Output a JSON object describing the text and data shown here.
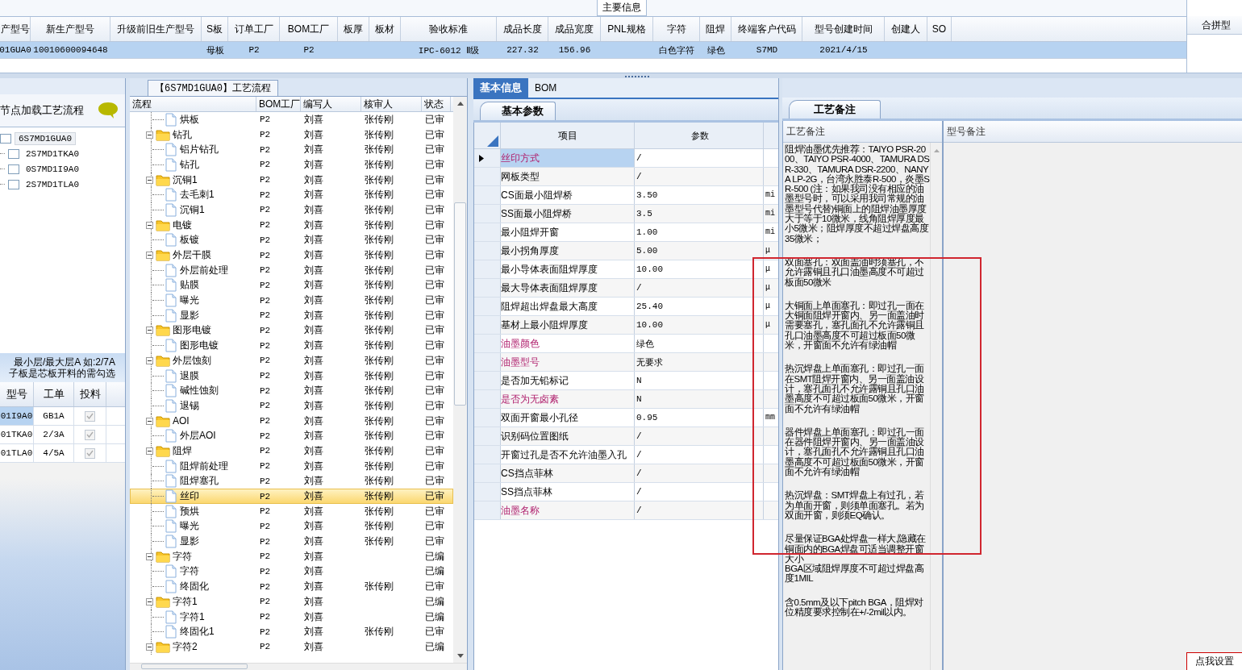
{
  "main_info": {
    "title": "主要信息",
    "columns": [
      "产型号",
      "新生产型号",
      "升级前旧生产型号",
      "S板",
      "订单工厂",
      "BOM工厂",
      "板厚",
      "板材",
      "验收标准",
      "成品长度",
      "成品宽度",
      "PNL规格",
      "字符",
      "阻焊",
      "终端客户代码",
      "型号创建时间",
      "创建人",
      "SO"
    ],
    "rows": [
      {
        "selected": true,
        "cells": [
          "01GUA0",
          "10010600094648",
          null,
          "母板",
          "P2",
          "P2",
          null,
          null,
          "IPC-6012 Ⅱ级",
          "227.32",
          "156.96",
          null,
          "白色字符",
          "绿色",
          "S7MD",
          "2021/4/15",
          null,
          null
        ]
      }
    ],
    "merge_title": "合拼型"
  },
  "left_panel": {
    "title": "节点加载工艺流程",
    "tree": {
      "label": "6S7MD1GUA0",
      "checked": false,
      "selected": true,
      "children": [
        {
          "label": "2S7MD1TKA0",
          "checked": false,
          "selected": false
        },
        {
          "label": "0S7MD1I9A0",
          "checked": false,
          "selected": false
        },
        {
          "label": "2S7MD1TLA0",
          "checked": false,
          "selected": false
        }
      ]
    },
    "note": [
      "最小层/最大层A 如:2/7A",
      "子板是芯板开料的需勾选"
    ],
    "columns": [
      "型号",
      "工单",
      "投料"
    ],
    "rows": [
      {
        "model": "01I9A0",
        "order": "GB1A",
        "fed": true,
        "selected": true
      },
      {
        "model": "01TKA0",
        "order": "2/3A",
        "fed": true,
        "selected": false
      },
      {
        "model": "01TLA0",
        "order": "4/5A",
        "fed": true,
        "selected": false
      }
    ]
  },
  "flow": {
    "title": "【6S7MD1GUA0】工艺流程",
    "columns": [
      "流程",
      "BOM工厂",
      "编写人",
      "核审人",
      "状态"
    ],
    "rows": [
      {
        "kind": "file",
        "name": "烘板",
        "bom": "P2",
        "writer": "刘喜",
        "reviewer": "张传刚",
        "status": "已审",
        "selected": false
      },
      {
        "kind": "folder",
        "name": "钻孔",
        "bom": "P2",
        "writer": "刘喜",
        "reviewer": "张传刚",
        "status": "已审",
        "selected": false,
        "expanded": true,
        "children": [
          {
            "kind": "file",
            "name": "铝片钻孔",
            "bom": "P2",
            "writer": "刘喜",
            "reviewer": "张传刚",
            "status": "已审",
            "selected": false
          },
          {
            "kind": "file",
            "name": "钻孔",
            "bom": "P2",
            "writer": "刘喜",
            "reviewer": "张传刚",
            "status": "已审",
            "selected": false
          }
        ]
      },
      {
        "kind": "folder",
        "name": "沉铜1",
        "bom": "P2",
        "writer": "刘喜",
        "reviewer": "张传刚",
        "status": "已审",
        "selected": false,
        "expanded": true,
        "children": [
          {
            "kind": "file",
            "name": "去毛刺1",
            "bom": "P2",
            "writer": "刘喜",
            "reviewer": "张传刚",
            "status": "已审",
            "selected": false
          },
          {
            "kind": "file",
            "name": "沉铜1",
            "bom": "P2",
            "writer": "刘喜",
            "reviewer": "张传刚",
            "status": "已审",
            "selected": false
          }
        ]
      },
      {
        "kind": "folder",
        "name": "电镀",
        "bom": "P2",
        "writer": "刘喜",
        "reviewer": "张传刚",
        "status": "已审",
        "selected": false,
        "expanded": true,
        "children": [
          {
            "kind": "file",
            "name": "板镀",
            "bom": "P2",
            "writer": "刘喜",
            "reviewer": "张传刚",
            "status": "已审",
            "selected": false
          }
        ]
      },
      {
        "kind": "folder",
        "name": "外层干膜",
        "bom": "P2",
        "writer": "刘喜",
        "reviewer": "张传刚",
        "status": "已审",
        "selected": false,
        "expanded": true,
        "children": [
          {
            "kind": "file",
            "name": "外层前处理",
            "bom": "P2",
            "writer": "刘喜",
            "reviewer": "张传刚",
            "status": "已审",
            "selected": false
          },
          {
            "kind": "file",
            "name": "贴膜",
            "bom": "P2",
            "writer": "刘喜",
            "reviewer": "张传刚",
            "status": "已审",
            "selected": false
          },
          {
            "kind": "file",
            "name": "曝光",
            "bom": "P2",
            "writer": "刘喜",
            "reviewer": "张传刚",
            "status": "已审",
            "selected": false
          },
          {
            "kind": "file",
            "name": "显影",
            "bom": "P2",
            "writer": "刘喜",
            "reviewer": "张传刚",
            "status": "已审",
            "selected": false
          }
        ]
      },
      {
        "kind": "folder",
        "name": "图形电镀",
        "bom": "P2",
        "writer": "刘喜",
        "reviewer": "张传刚",
        "status": "已审",
        "selected": false,
        "expanded": true,
        "children": [
          {
            "kind": "file",
            "name": "图形电镀",
            "bom": "P2",
            "writer": "刘喜",
            "reviewer": "张传刚",
            "status": "已审",
            "selected": false
          }
        ]
      },
      {
        "kind": "folder",
        "name": "外层蚀刻",
        "bom": "P2",
        "writer": "刘喜",
        "reviewer": "张传刚",
        "status": "已审",
        "selected": false,
        "expanded": true,
        "children": [
          {
            "kind": "file",
            "name": "退膜",
            "bom": "P2",
            "writer": "刘喜",
            "reviewer": "张传刚",
            "status": "已审",
            "selected": false
          },
          {
            "kind": "file",
            "name": "碱性蚀刻",
            "bom": "P2",
            "writer": "刘喜",
            "reviewer": "张传刚",
            "status": "已审",
            "selected": false
          },
          {
            "kind": "file",
            "name": "退锡",
            "bom": "P2",
            "writer": "刘喜",
            "reviewer": "张传刚",
            "status": "已审",
            "selected": false
          }
        ]
      },
      {
        "kind": "folder",
        "name": "AOI",
        "bom": "P2",
        "writer": "刘喜",
        "reviewer": "张传刚",
        "status": "已审",
        "selected": false,
        "expanded": true,
        "children": [
          {
            "kind": "file",
            "name": "外层AOI",
            "bom": "P2",
            "writer": "刘喜",
            "reviewer": "张传刚",
            "status": "已审",
            "selected": false
          }
        ]
      },
      {
        "kind": "folder",
        "name": "阻焊",
        "bom": "P2",
        "writer": "刘喜",
        "reviewer": "张传刚",
        "status": "已审",
        "selected": false,
        "expanded": true,
        "children": [
          {
            "kind": "file",
            "name": "阻焊前处理",
            "bom": "P2",
            "writer": "刘喜",
            "reviewer": "张传刚",
            "status": "已审",
            "selected": false
          },
          {
            "kind": "file",
            "name": "阻焊塞孔",
            "bom": "P2",
            "writer": "刘喜",
            "reviewer": "张传刚",
            "status": "已审",
            "selected": false
          },
          {
            "kind": "file",
            "name": "丝印",
            "bom": "P2",
            "writer": "刘喜",
            "reviewer": "张传刚",
            "status": "已审",
            "selected": true
          },
          {
            "kind": "file",
            "name": "预烘",
            "bom": "P2",
            "writer": "刘喜",
            "reviewer": "张传刚",
            "status": "已审",
            "selected": false
          },
          {
            "kind": "file",
            "name": "曝光",
            "bom": "P2",
            "writer": "刘喜",
            "reviewer": "张传刚",
            "status": "已审",
            "selected": false
          },
          {
            "kind": "file",
            "name": "显影",
            "bom": "P2",
            "writer": "刘喜",
            "reviewer": "张传刚",
            "status": "已审",
            "selected": false
          }
        ]
      },
      {
        "kind": "folder",
        "name": "字符",
        "bom": "P2",
        "writer": "刘喜",
        "status": "已编",
        "selected": false,
        "expanded": true,
        "children": [
          {
            "kind": "file",
            "name": "字符",
            "bom": "P2",
            "writer": "刘喜",
            "status": "已编",
            "selected": false
          },
          {
            "kind": "file",
            "name": "终固化",
            "bom": "P2",
            "writer": "刘喜",
            "reviewer": "张传刚",
            "status": "已审",
            "selected": false
          }
        ]
      },
      {
        "kind": "folder",
        "name": "字符1",
        "bom": "P2",
        "writer": "刘喜",
        "status": "已编",
        "selected": false,
        "expanded": true,
        "children": [
          {
            "kind": "file",
            "name": "字符1",
            "bom": "P2",
            "writer": "刘喜",
            "status": "已编",
            "selected": false
          },
          {
            "kind": "file",
            "name": "终固化1",
            "bom": "P2",
            "writer": "刘喜",
            "reviewer": "张传刚",
            "status": "已审",
            "selected": false
          }
        ]
      },
      {
        "kind": "folder",
        "name": "字符2",
        "bom": "P2",
        "writer": "刘喜",
        "status": "已编",
        "selected": false,
        "expanded": true
      }
    ]
  },
  "tabs": [
    {
      "label": "基本信息",
      "selected": true
    },
    {
      "label": "BOM",
      "selected": false
    }
  ],
  "params": {
    "tab": "基本参数",
    "columns": [
      "项目",
      "参数"
    ],
    "rows": [
      {
        "name": "丝印方式",
        "value": "/",
        "required": true,
        "selected": true
      },
      {
        "name": "网板类型",
        "value": "/",
        "required": false,
        "selected": false
      },
      {
        "name": "CS面最小阻焊桥",
        "value": "3.50",
        "unit": "mi",
        "required": false,
        "selected": false
      },
      {
        "name": "SS面最小阻焊桥",
        "value": "3.5",
        "unit": "mi",
        "required": false,
        "selected": false
      },
      {
        "name": "最小阻焊开窗",
        "value": "1.00",
        "unit": "mi",
        "required": false,
        "selected": false
      },
      {
        "name": "最小拐角厚度",
        "value": "5.00",
        "unit": "μ",
        "required": false,
        "selected": false
      },
      {
        "name": "最小导体表面阻焊厚度",
        "value": "10.00",
        "unit": "μ",
        "required": false,
        "selected": false
      },
      {
        "name": "最大导体表面阻焊厚度",
        "value": "/",
        "unit": "μ",
        "required": false,
        "selected": false
      },
      {
        "name": "阻焊超出焊盘最大高度",
        "value": "25.40",
        "unit": "μ",
        "required": false,
        "selected": false
      },
      {
        "name": "基材上最小阻焊厚度",
        "value": "10.00",
        "unit": "μ",
        "required": false,
        "selected": false
      },
      {
        "name": "油墨颜色",
        "value": "绿色",
        "required": true,
        "selected": false
      },
      {
        "name": "油墨型号",
        "value": "无要求",
        "required": true,
        "selected": false
      },
      {
        "name": "是否加无铅标记",
        "value": "N",
        "required": false,
        "selected": false
      },
      {
        "name": "是否为无卤素",
        "value": "N",
        "required": true,
        "selected": false
      },
      {
        "name": "双面开窗最小孔径",
        "value": "0.95",
        "unit": "mm",
        "required": false,
        "selected": false
      },
      {
        "name": "识别码位置图纸",
        "value": "/",
        "required": false,
        "selected": false
      },
      {
        "name": "开窗过孔是否不允许油墨入孔",
        "value": "/",
        "required": false,
        "selected": false
      },
      {
        "name": "CS挡点菲林",
        "value": "/",
        "required": false,
        "selected": false
      },
      {
        "name": "SS挡点菲林",
        "value": "/",
        "required": false,
        "selected": false
      },
      {
        "name": "油墨名称",
        "value": "/",
        "required": true,
        "selected": false
      }
    ]
  },
  "notes": {
    "tab": "工艺备注",
    "columns": [
      "工艺备注",
      "型号备注"
    ],
    "blocks": [
      [
        "阻焊油墨优先推荐：TAIYO PSR-2000、TAIYO PSR-4000、TAMURA DSR-330、TAMURA DSR-2200、NANYA LP-2G，台湾永胜泰R-500，炎墨SR-500 (注：如果我司没有相应的油墨型号时，可以采用我司常规的油墨型号代替)铜面上的阻焊油墨厚度大于等于10微米，线角阻焊厚度最小5微米；阻焊厚度不超过焊盘高度35微米；"
      ],
      [
        "双面塞孔：双面盖油时须塞孔，不允许露铜且孔口油墨高度不可超过板面50微米"
      ],
      [
        "大铜面上单面塞孔：即过孔一面在大铜面阻焊开窗内、另一面盖油时需要塞孔，塞孔面孔不允许露铜且孔口油墨高度不可超过板面50微米，开窗面不允许有绿油帽"
      ],
      [
        "热沉焊盘上单面塞孔：即过孔一面在SMT阻焊开窗内、另一面盖油设计，塞孔面孔不允许露铜且孔口油墨高度不可超过板面50微米，开窗面不允许有绿油帽"
      ],
      [
        "器件焊盘上单面塞孔：即过孔一面在器件阻焊开窗内、另一面盖油设计，塞孔面孔不允许露铜且孔口油墨高度不可超过板面50微米，开窗面不允许有绿油帽"
      ],
      [
        "热沉焊盘：SMT焊盘上有过孔，若为单面开窗，则须单面塞孔。若为双面开窗，则须EQ确认。"
      ],
      [
        "尽量保证BGA处焊盘一样大,隐藏在铜面内的BGA焊盘可适当调整开窗大小",
        "BGA区域阻焊厚度不可超过焊盘高度1MIL"
      ],
      [
        "含0.5mm及以下pitch BGA，阻焊对位精度要求控制在+/-2mil以内。"
      ]
    ]
  },
  "settings_button": "点我设置"
}
